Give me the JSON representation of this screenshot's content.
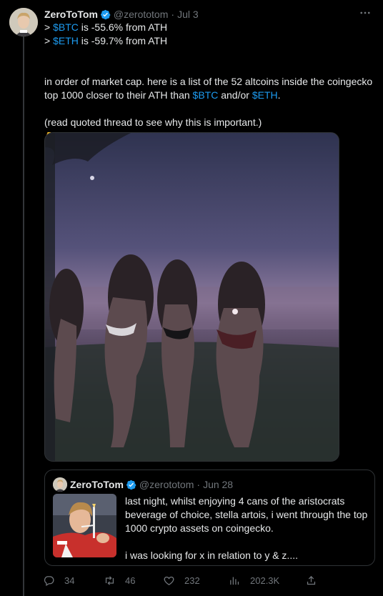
{
  "tweet": {
    "author_name": "ZeroToTom",
    "handle": "@zerototom",
    "separator": "·",
    "date": "Jul 3",
    "line1": {
      "prefix": "> ",
      "ticker": "$BTC",
      "suffix": " is -55.6% from ATH"
    },
    "line2": {
      "prefix": "> ",
      "ticker": "$ETH",
      "suffix": " is -59.7% from ATH"
    },
    "para2": {
      "part1": "in order of market cap. here is a list of the 52 altcoins inside the coingecko top 1000 closer to their ATH than ",
      "ticker1": "$BTC",
      "mid": " and/or ",
      "ticker2": "$ETH",
      "end": "."
    },
    "para3": "(read quoted thread to see why this is important.)",
    "emoji": "👇"
  },
  "quote": {
    "author_name": "ZeroToTom",
    "handle": "@zerototom",
    "separator": "·",
    "date": "Jun 28",
    "text1": "last night, whilst enjoying 4 cans of the aristocrats beverage of choice, stella artois, i went through the top 1000 crypto assets on coingecko.",
    "text2": "i was looking for x in relation to y & z...."
  },
  "actions": {
    "replies": "34",
    "reposts": "46",
    "likes": "232",
    "views": "202.3K"
  },
  "icons": {
    "more": "more-icon",
    "verified": "verified-badge-icon",
    "reply": "reply-icon",
    "repost": "repost-icon",
    "like": "like-icon",
    "views": "views-icon",
    "share": "share-icon"
  },
  "colors": {
    "background": "#000000",
    "text": "#e7e9ea",
    "muted": "#71767b",
    "link": "#1d9bf0",
    "border": "#2f3336"
  }
}
